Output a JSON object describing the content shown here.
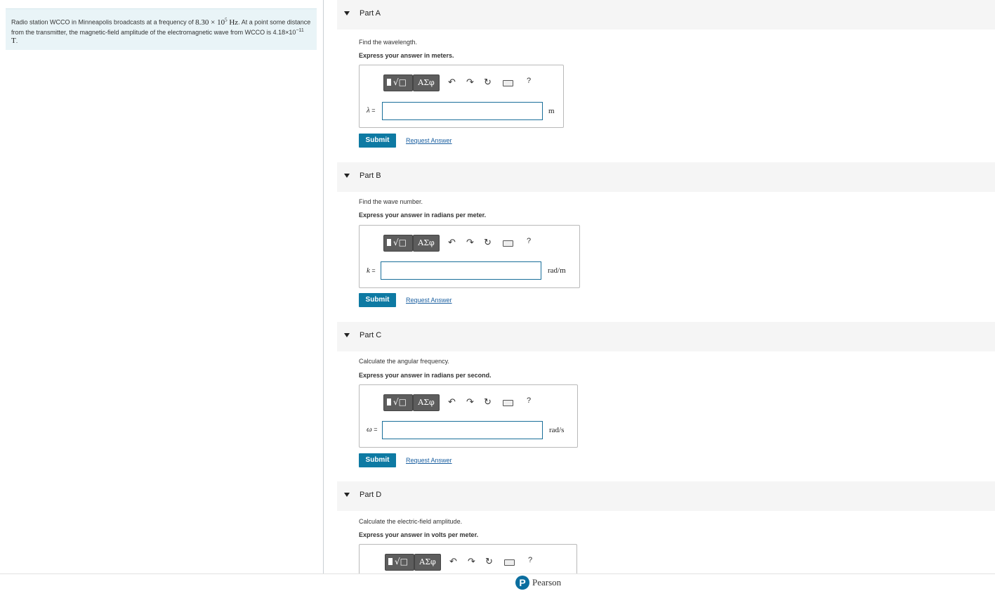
{
  "problem": {
    "text1": "Radio station WCCO in Minneapolis broadcasts at a frequency of ",
    "freq": "8.30 × 10",
    "freq_exp": "5",
    "freq_unit": " Hz",
    "text2": ". At a point some distance from the transmitter, the magnetic-field amplitude of the electromagnetic wave from WCCO is 4.18×10",
    "b_exp": "−11",
    "b_unit": " T",
    "text3": "."
  },
  "toolbar": {
    "greek": "ΑΣφ",
    "undo": "↶",
    "redo": "↷",
    "reset": "↻",
    "help": "?",
    "icons": [
      "templates-icon",
      "greek-letters-icon",
      "undo-icon",
      "redo-icon",
      "reset-icon",
      "keyboard-icon",
      "help-icon"
    ]
  },
  "parts": {
    "a": {
      "label": "Part A",
      "prompt": "Find the wavelength.",
      "instruction": "Express your answer in meters.",
      "var": "λ",
      "eq": " =",
      "value": "",
      "unit": "m",
      "submit": "Submit",
      "request": "Request Answer"
    },
    "b": {
      "label": "Part B",
      "prompt": "Find the wave number.",
      "instruction": "Express your answer in radians per meter.",
      "var": "k",
      "eq": " =",
      "value": "",
      "unit": "rad/m",
      "submit": "Submit",
      "request": "Request Answer"
    },
    "c": {
      "label": "Part C",
      "prompt": "Calculate the angular frequency.",
      "instruction": "Express your answer in radians per second.",
      "var": "ω",
      "eq": " =",
      "value": "",
      "unit": "rad/s",
      "submit": "Submit",
      "request": "Request Answer"
    },
    "d": {
      "label": "Part D",
      "prompt": "Calculate the electric-field amplitude.",
      "instruction": "Express your answer in volts per meter."
    }
  },
  "footer": {
    "logo_letter": "P",
    "brand": "Pearson"
  },
  "colors": {
    "accent": "#0e7aa3",
    "input_border": "#1a6f9a",
    "link": "#1a5fa0",
    "problem_bg": "#e9f4f7",
    "part_header_bg": "#f5f5f5"
  }
}
